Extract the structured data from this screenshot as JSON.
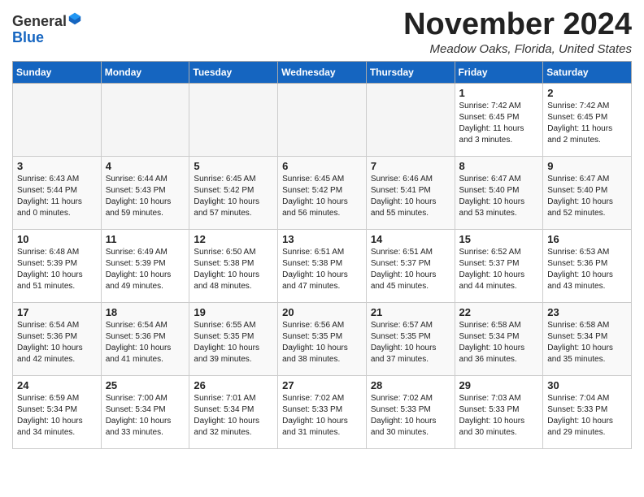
{
  "header": {
    "logo_line1": "General",
    "logo_line2": "Blue",
    "month_title": "November 2024",
    "location": "Meadow Oaks, Florida, United States"
  },
  "days_of_week": [
    "Sunday",
    "Monday",
    "Tuesday",
    "Wednesday",
    "Thursday",
    "Friday",
    "Saturday"
  ],
  "weeks": [
    [
      {
        "day": "",
        "text": ""
      },
      {
        "day": "",
        "text": ""
      },
      {
        "day": "",
        "text": ""
      },
      {
        "day": "",
        "text": ""
      },
      {
        "day": "",
        "text": ""
      },
      {
        "day": "1",
        "text": "Sunrise: 7:42 AM\nSunset: 6:45 PM\nDaylight: 11 hours\nand 3 minutes."
      },
      {
        "day": "2",
        "text": "Sunrise: 7:42 AM\nSunset: 6:45 PM\nDaylight: 11 hours\nand 2 minutes."
      }
    ],
    [
      {
        "day": "3",
        "text": "Sunrise: 6:43 AM\nSunset: 5:44 PM\nDaylight: 11 hours\nand 0 minutes."
      },
      {
        "day": "4",
        "text": "Sunrise: 6:44 AM\nSunset: 5:43 PM\nDaylight: 10 hours\nand 59 minutes."
      },
      {
        "day": "5",
        "text": "Sunrise: 6:45 AM\nSunset: 5:42 PM\nDaylight: 10 hours\nand 57 minutes."
      },
      {
        "day": "6",
        "text": "Sunrise: 6:45 AM\nSunset: 5:42 PM\nDaylight: 10 hours\nand 56 minutes."
      },
      {
        "day": "7",
        "text": "Sunrise: 6:46 AM\nSunset: 5:41 PM\nDaylight: 10 hours\nand 55 minutes."
      },
      {
        "day": "8",
        "text": "Sunrise: 6:47 AM\nSunset: 5:40 PM\nDaylight: 10 hours\nand 53 minutes."
      },
      {
        "day": "9",
        "text": "Sunrise: 6:47 AM\nSunset: 5:40 PM\nDaylight: 10 hours\nand 52 minutes."
      }
    ],
    [
      {
        "day": "10",
        "text": "Sunrise: 6:48 AM\nSunset: 5:39 PM\nDaylight: 10 hours\nand 51 minutes."
      },
      {
        "day": "11",
        "text": "Sunrise: 6:49 AM\nSunset: 5:39 PM\nDaylight: 10 hours\nand 49 minutes."
      },
      {
        "day": "12",
        "text": "Sunrise: 6:50 AM\nSunset: 5:38 PM\nDaylight: 10 hours\nand 48 minutes."
      },
      {
        "day": "13",
        "text": "Sunrise: 6:51 AM\nSunset: 5:38 PM\nDaylight: 10 hours\nand 47 minutes."
      },
      {
        "day": "14",
        "text": "Sunrise: 6:51 AM\nSunset: 5:37 PM\nDaylight: 10 hours\nand 45 minutes."
      },
      {
        "day": "15",
        "text": "Sunrise: 6:52 AM\nSunset: 5:37 PM\nDaylight: 10 hours\nand 44 minutes."
      },
      {
        "day": "16",
        "text": "Sunrise: 6:53 AM\nSunset: 5:36 PM\nDaylight: 10 hours\nand 43 minutes."
      }
    ],
    [
      {
        "day": "17",
        "text": "Sunrise: 6:54 AM\nSunset: 5:36 PM\nDaylight: 10 hours\nand 42 minutes."
      },
      {
        "day": "18",
        "text": "Sunrise: 6:54 AM\nSunset: 5:36 PM\nDaylight: 10 hours\nand 41 minutes."
      },
      {
        "day": "19",
        "text": "Sunrise: 6:55 AM\nSunset: 5:35 PM\nDaylight: 10 hours\nand 39 minutes."
      },
      {
        "day": "20",
        "text": "Sunrise: 6:56 AM\nSunset: 5:35 PM\nDaylight: 10 hours\nand 38 minutes."
      },
      {
        "day": "21",
        "text": "Sunrise: 6:57 AM\nSunset: 5:35 PM\nDaylight: 10 hours\nand 37 minutes."
      },
      {
        "day": "22",
        "text": "Sunrise: 6:58 AM\nSunset: 5:34 PM\nDaylight: 10 hours\nand 36 minutes."
      },
      {
        "day": "23",
        "text": "Sunrise: 6:58 AM\nSunset: 5:34 PM\nDaylight: 10 hours\nand 35 minutes."
      }
    ],
    [
      {
        "day": "24",
        "text": "Sunrise: 6:59 AM\nSunset: 5:34 PM\nDaylight: 10 hours\nand 34 minutes."
      },
      {
        "day": "25",
        "text": "Sunrise: 7:00 AM\nSunset: 5:34 PM\nDaylight: 10 hours\nand 33 minutes."
      },
      {
        "day": "26",
        "text": "Sunrise: 7:01 AM\nSunset: 5:34 PM\nDaylight: 10 hours\nand 32 minutes."
      },
      {
        "day": "27",
        "text": "Sunrise: 7:02 AM\nSunset: 5:33 PM\nDaylight: 10 hours\nand 31 minutes."
      },
      {
        "day": "28",
        "text": "Sunrise: 7:02 AM\nSunset: 5:33 PM\nDaylight: 10 hours\nand 30 minutes."
      },
      {
        "day": "29",
        "text": "Sunrise: 7:03 AM\nSunset: 5:33 PM\nDaylight: 10 hours\nand 30 minutes."
      },
      {
        "day": "30",
        "text": "Sunrise: 7:04 AM\nSunset: 5:33 PM\nDaylight: 10 hours\nand 29 minutes."
      }
    ]
  ]
}
